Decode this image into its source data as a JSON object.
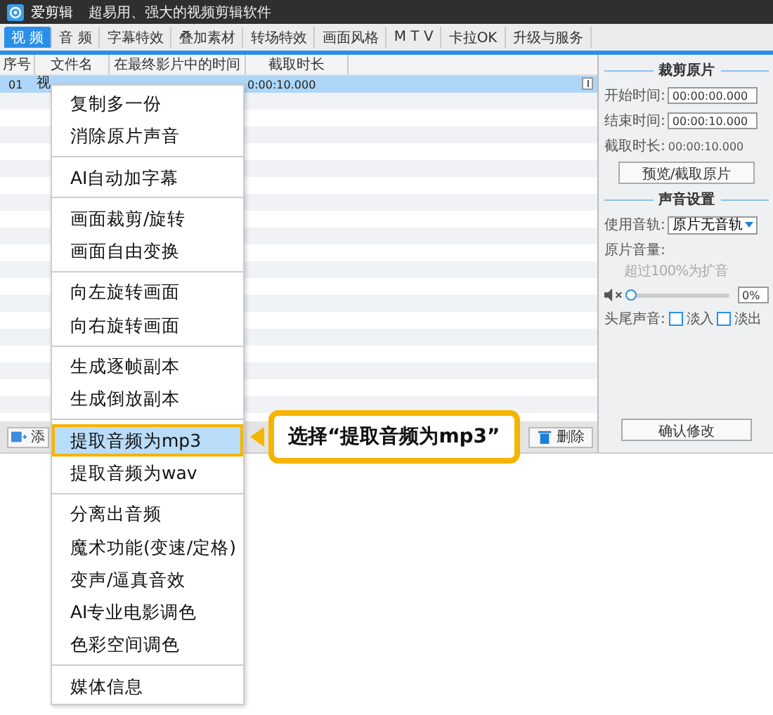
{
  "window": {
    "app_name": "爱剪辑",
    "slogan": "超易用、强大的视频剪辑软件"
  },
  "tabs": [
    {
      "label": "视 频",
      "selected": true
    },
    {
      "label": "音 频",
      "selected": false
    },
    {
      "label": "字幕特效",
      "selected": false
    },
    {
      "label": "叠加素材",
      "selected": false
    },
    {
      "label": "转场特效",
      "selected": false
    },
    {
      "label": "画面风格",
      "selected": false
    },
    {
      "label": "M T V",
      "selected": false
    },
    {
      "label": "卡拉OK",
      "selected": false
    },
    {
      "label": "升级与服务",
      "selected": false
    }
  ],
  "table": {
    "columns": [
      "序号",
      "文件名",
      "在最终影片中的时间",
      "截取时长"
    ],
    "rows": [
      {
        "index": "01",
        "file": "视",
        "duration": "0:00:10.000",
        "selected": true
      }
    ]
  },
  "bottom_bar": {
    "add_button": "添",
    "delete_button": "删除"
  },
  "panel": {
    "clip_title": "裁剪原片",
    "start_label": "开始时间:",
    "start_value": "00:00:00.000",
    "end_label": "结束时间:",
    "end_value": "00:00:10.000",
    "length_label": "截取时长:",
    "length_value": "00:00:10.000",
    "preview_button": "预览/截取原片",
    "sound_title": "声音设置",
    "track_label": "使用音轨:",
    "track_value": "原片无音轨",
    "volume_label": "原片音量:",
    "volume_hint": "超过100%为扩音",
    "volume": {
      "level": 0,
      "reading": "0%"
    },
    "fade_label": "头尾声音:",
    "fade_in": {
      "label": "淡入",
      "checked": false
    },
    "fade_out": {
      "label": "淡出",
      "checked": false
    },
    "confirm_button": "确认修改"
  },
  "menu": {
    "groups": [
      [
        {
          "label": "复制多一份",
          "selected": false
        },
        {
          "label": "消除原片声音",
          "selected": false
        }
      ],
      [
        {
          "label": "AI自动加字幕",
          "selected": false
        }
      ],
      [
        {
          "label": "画面裁剪/旋转",
          "selected": false
        },
        {
          "label": "画面自由变换",
          "selected": false
        }
      ],
      [
        {
          "label": "向左旋转画面",
          "selected": false
        },
        {
          "label": "向右旋转画面",
          "selected": false
        }
      ],
      [
        {
          "label": "生成逐帧副本",
          "selected": false
        },
        {
          "label": "生成倒放副本",
          "selected": false
        }
      ],
      [
        {
          "label": "提取音频为mp3",
          "selected": true
        },
        {
          "label": "提取音频为wav",
          "selected": false
        }
      ],
      [
        {
          "label": "分离出音频",
          "selected": false
        },
        {
          "label": "魔术功能(变速/定格)",
          "selected": false
        },
        {
          "label": "变声/逼真音效",
          "selected": false
        },
        {
          "label": "AI专业电影调色",
          "selected": false
        },
        {
          "label": "色彩空间调色",
          "selected": false
        }
      ],
      [
        {
          "label": "媒体信息",
          "selected": false
        }
      ]
    ]
  },
  "callout": {
    "text": "选择“提取音频为mp3”"
  }
}
